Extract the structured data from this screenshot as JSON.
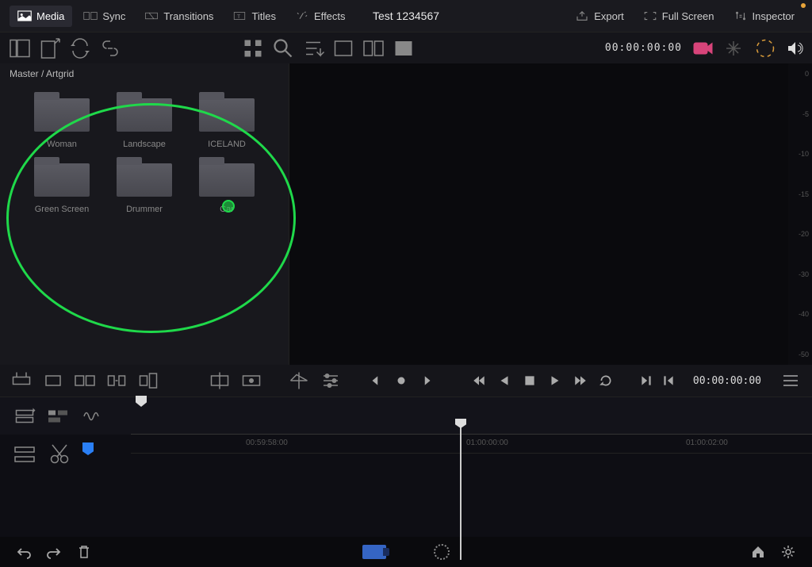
{
  "topbar": {
    "media": "Media",
    "sync": "Sync",
    "transitions": "Transitions",
    "titles": "Titles",
    "effects": "Effects",
    "export": "Export",
    "fullscreen": "Full Screen",
    "inspector": "Inspector"
  },
  "project_title": "Test 1234567",
  "timecode_viewer": "00:00:00:00",
  "breadcrumb": "Master / Artgrid",
  "folders": [
    {
      "label": "Woman"
    },
    {
      "label": "Landscape"
    },
    {
      "label": "ICELAND"
    },
    {
      "label": "Green Screen"
    },
    {
      "label": "Drummer"
    },
    {
      "label": "Car"
    }
  ],
  "level_marks": [
    "0",
    "-5",
    "-10",
    "-15",
    "-20",
    "-30",
    "-40",
    "-50"
  ],
  "timecode_player": "00:00:00:00",
  "timeline_ticks": [
    {
      "pos": "145px",
      "label": "00:59:58:00"
    },
    {
      "pos": "423px",
      "label": "01:00:00:00"
    },
    {
      "pos": "700px",
      "label": "01:00:02:00"
    }
  ]
}
